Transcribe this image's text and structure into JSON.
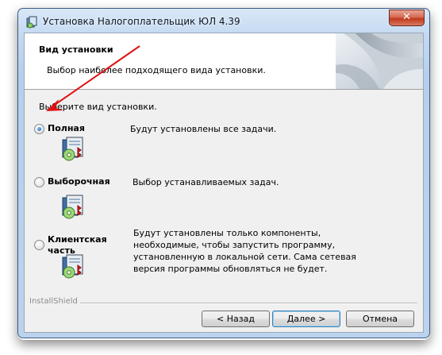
{
  "window": {
    "title": "Установка Налогоплательщик ЮЛ 4.39",
    "close_glyph": "✕"
  },
  "header": {
    "title": "Вид установки",
    "subtitle": "Выбор наиболее подходящего вида установки."
  },
  "body": {
    "prompt": "Выберите вид установки.",
    "options": [
      {
        "label": "Полная",
        "description": "Будут установлены все задачи.",
        "selected": true,
        "icon": "package-icon"
      },
      {
        "label": "Выборочная",
        "description": "Выбор устанавливаемых задач.",
        "selected": false,
        "icon": "package-icon"
      },
      {
        "label_line1": "Клиентская",
        "label_line2": "часть",
        "description": "Будут установлены только компоненты, необходимые, чтобы запустить программу, установленную в локальной сети. Сама сетевая версия программы обновляться не будет.",
        "selected": false,
        "icon": "package-icon"
      }
    ]
  },
  "footer": {
    "brand": "InstallShield",
    "back_label": "< Назад",
    "next_label": "Далее >",
    "cancel_label": "Отмена"
  },
  "annotation": {
    "color": "#e01010",
    "icon": "red-arrow"
  }
}
